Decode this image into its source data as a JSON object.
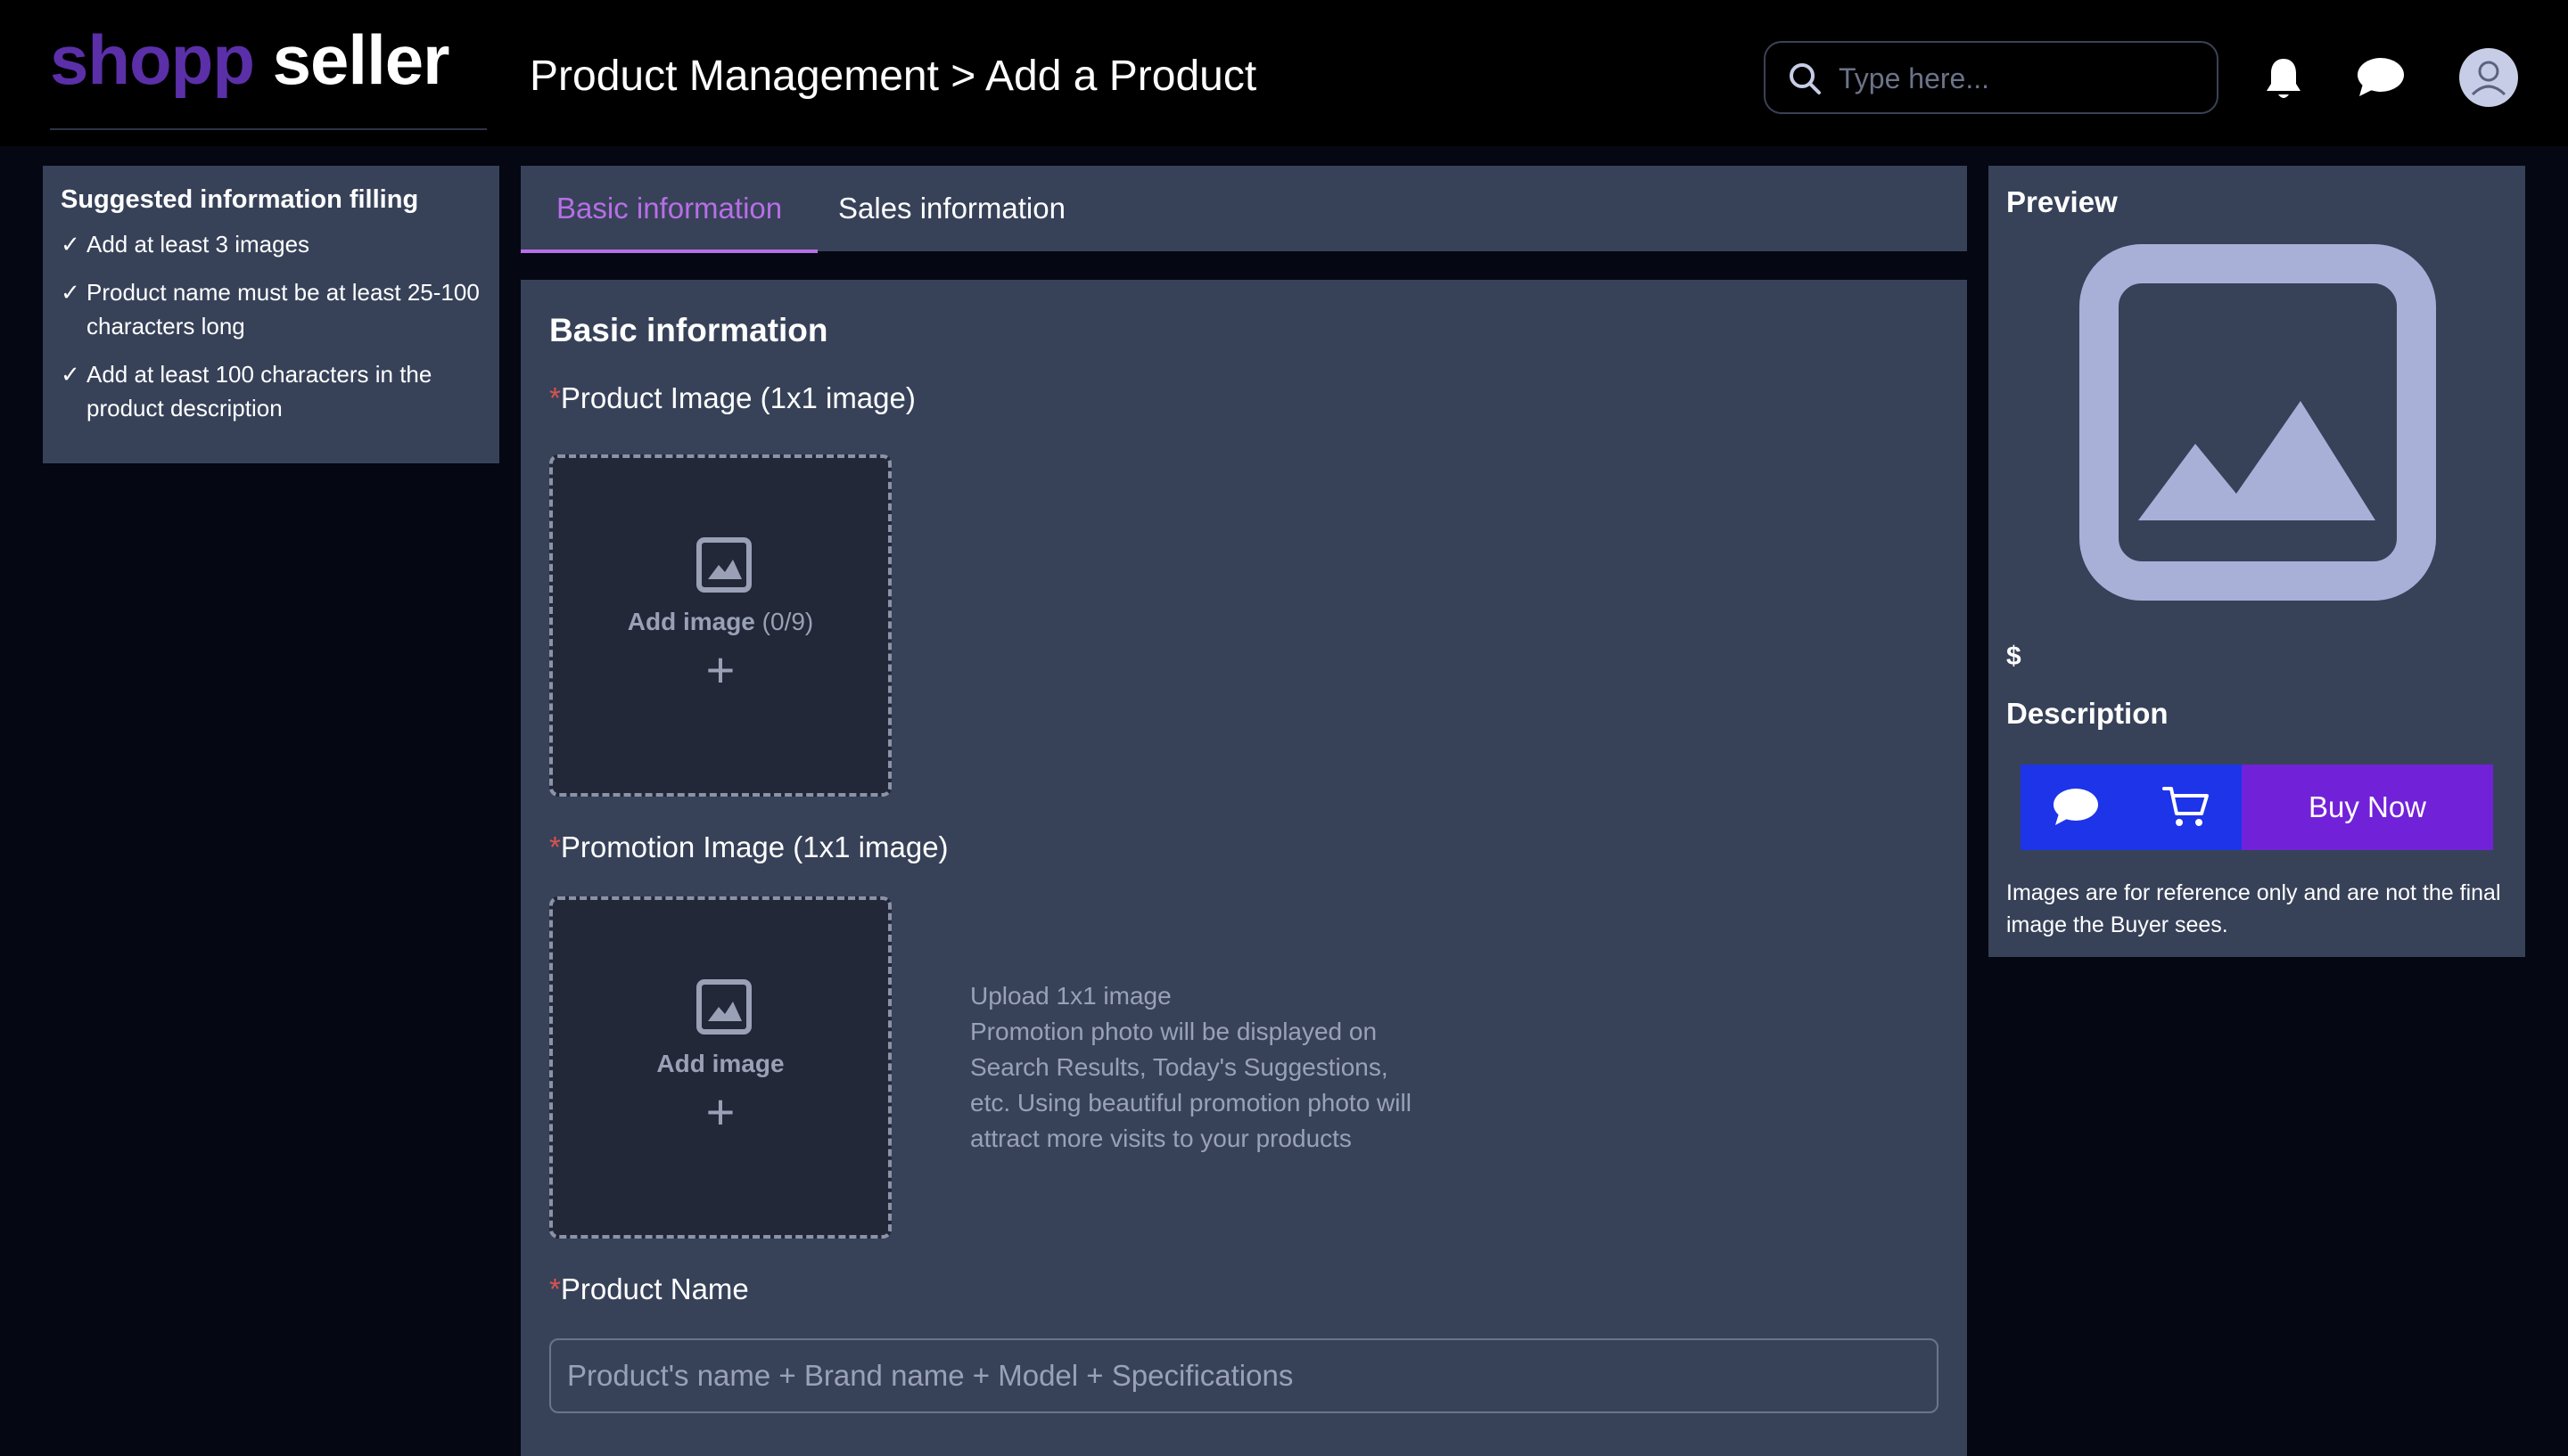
{
  "brand": {
    "part1": "shopp",
    "part2": "seller"
  },
  "header": {
    "title": "Product Management > Add a Product",
    "search_placeholder": "Type here..."
  },
  "tips": {
    "title": "Suggested information filling",
    "check": "✓",
    "items": [
      "Add at least 3 images",
      "Product name must be at least 25-100 characters long",
      "Add at least 100 characters in the product description"
    ]
  },
  "tabs": [
    {
      "label": "Basic information",
      "active": true
    },
    {
      "label": "Sales information",
      "active": false
    }
  ],
  "form": {
    "section_title": "Basic information",
    "required_mark": "*",
    "product_image": {
      "label": "Product Image (1x1 image)",
      "add_label": "Add image",
      "count": "(0/9)",
      "plus": "+"
    },
    "promotion_image": {
      "label": "Promotion Image (1x1 image)",
      "add_label": "Add image",
      "plus": "+",
      "hint": "Upload 1x1 image\nPromotion photo will be displayed on Search Results, Today's Suggestions, etc. Using beautiful promotion photo will attract more visits to your products",
      "hint_title": "Upload 1x1 image",
      "hint_body": "Promotion photo will be displayed on Search Results, Today's Suggestions, etc. Using beautiful promotion photo will attract more visits to your products"
    },
    "product_name": {
      "label": "Product Name",
      "value": "",
      "placeholder": "Product's name + Brand name + Model + Specifications"
    }
  },
  "preview": {
    "title": "Preview",
    "price": "$",
    "description_label": "Description",
    "buy_now": "Buy Now",
    "note": "Images are for reference only and are not the final image the Buyer sees."
  },
  "colors": {
    "brand_purple": "#5b2fa8",
    "tab_active": "#b86ee6",
    "panel_bg": "#374259",
    "chat_cart_bar": "#1d34e8",
    "buy_now_bg": "#7122d8",
    "required": "#d9534f"
  },
  "icons": [
    "search-icon",
    "bell-icon",
    "chat-icon",
    "user-icon",
    "image-icon",
    "plus-icon",
    "cart-icon"
  ]
}
